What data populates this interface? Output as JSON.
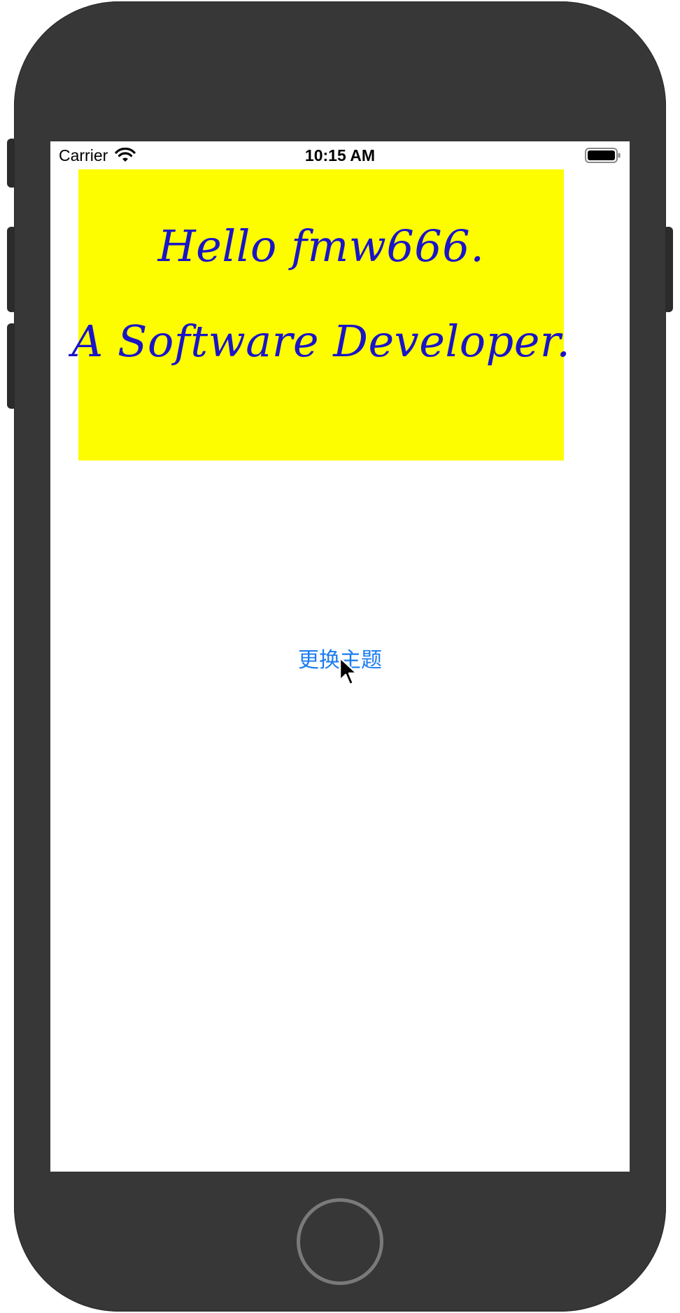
{
  "status_bar": {
    "carrier": "Carrier",
    "time": "10:15 AM",
    "icons": [
      "wifi-icon",
      "battery-icon"
    ]
  },
  "banner": {
    "line1": "Hello fmw666.",
    "line2": "A Software Developer.",
    "background_color": "#fdfd00",
    "text_color": "#1a14c8"
  },
  "theme_button": {
    "label": "更换主题",
    "color": "#1a7cf0"
  },
  "device": {
    "body_color": "#373737"
  }
}
